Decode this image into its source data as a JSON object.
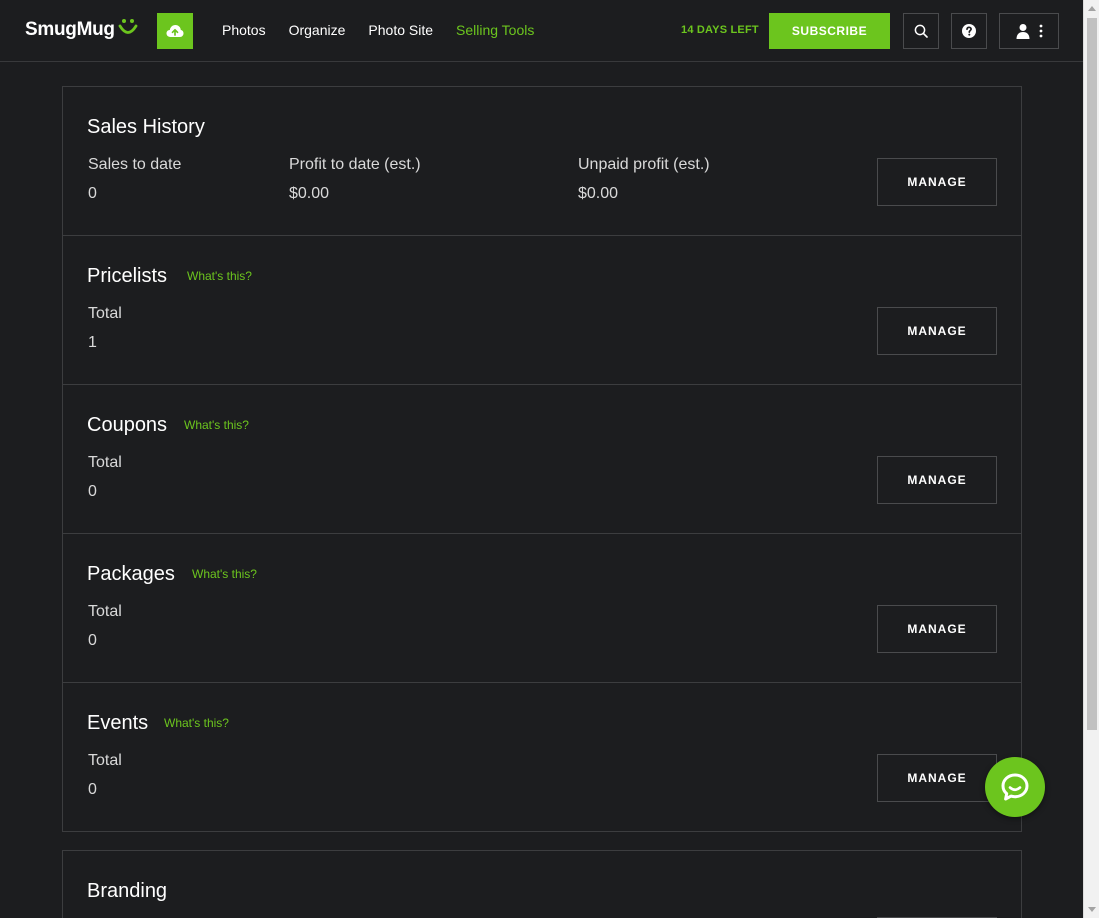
{
  "header": {
    "logo_text": "SmugMug",
    "nav": [
      {
        "label": "Photos"
      },
      {
        "label": "Organize"
      },
      {
        "label": "Photo Site"
      },
      {
        "label": "Selling Tools"
      }
    ],
    "days_left": "14 DAYS LEFT",
    "subscribe_label": "SUBSCRIBE",
    "icons": {
      "upload": "cloud-upload-icon",
      "search": "search-icon",
      "help": "question-circle-icon",
      "user": "user-icon",
      "more": "kebab-menu-icon"
    },
    "accent_color": "#6cc51e"
  },
  "sections": {
    "sales_history": {
      "title": "Sales History",
      "stats": [
        {
          "label": "Sales to date",
          "value": "0"
        },
        {
          "label": "Profit to date (est.)",
          "value": "$0.00"
        },
        {
          "label": "Unpaid profit (est.)",
          "value": "$0.00"
        }
      ],
      "button_label": "MANAGE"
    },
    "pricelists": {
      "title": "Pricelists",
      "whats_this": "What's this?",
      "stat_label": "Total",
      "stat_value": "1",
      "button_label": "MANAGE"
    },
    "coupons": {
      "title": "Coupons",
      "whats_this": "What's this?",
      "stat_label": "Total",
      "stat_value": "0",
      "button_label": "MANAGE"
    },
    "packages": {
      "title": "Packages",
      "whats_this": "What's this?",
      "stat_label": "Total",
      "stat_value": "0",
      "button_label": "MANAGE"
    },
    "events": {
      "title": "Events",
      "whats_this": "What's this?",
      "stat_label": "Total",
      "stat_value": "0",
      "button_label": "MANAGE"
    },
    "branding": {
      "title": "Branding"
    }
  },
  "chat": {
    "icon": "chat-bubble-icon"
  }
}
